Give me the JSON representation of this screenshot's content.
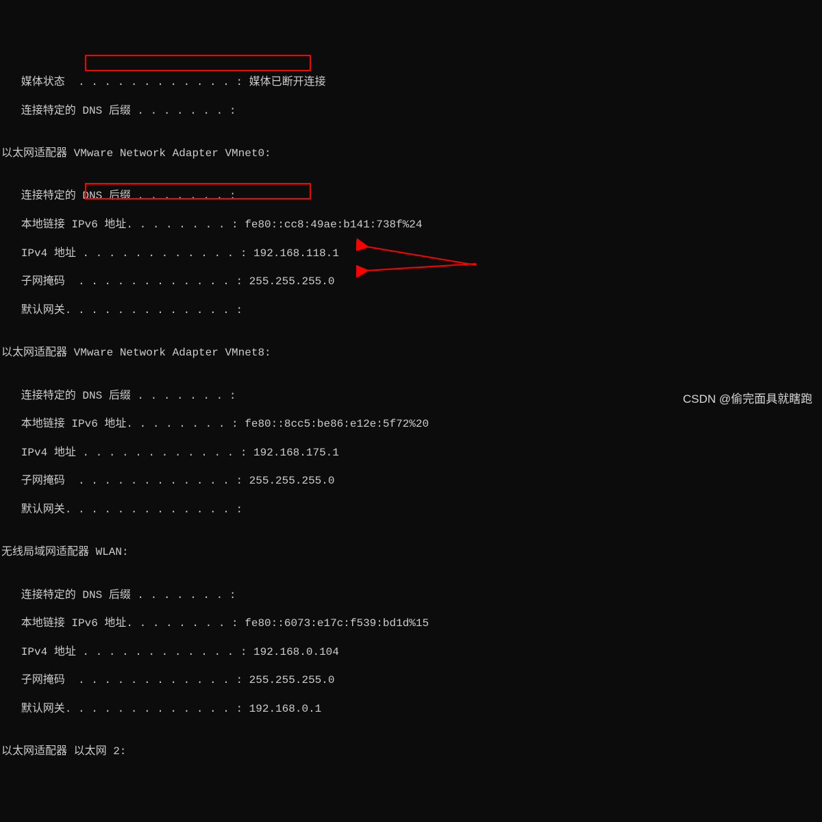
{
  "lines": {
    "l0": "   媒体状态  . . . . . . . . . . . . : 媒体已断开连接",
    "l1": "   连接特定的 DNS 后缀 . . . . . . . :",
    "l2": "",
    "l3_pre": "以太网适配器 ",
    "l3_box": "VMware Network Adapter VMnet0:",
    "l4": "",
    "l5": "   连接特定的 DNS 后缀 . . . . . . . :",
    "l6": "   本地链接 IPv6 地址. . . . . . . . : fe80::cc8:49ae:b141:738f%24",
    "l7": "   IPv4 地址 . . . . . . . . . . . . : 192.168.118.1",
    "l8": "   子网掩码  . . . . . . . . . . . . : 255.255.255.0",
    "l9": "   默认网关. . . . . . . . . . . . . :",
    "l10": "",
    "l11_pre": "以太网适配器 ",
    "l11_box": "VMware Network Adapter VMnet8:",
    "l12": "",
    "l13": "   连接特定的 DNS 后缀 . . . . . . . :",
    "l14": "   本地链接 IPv6 地址. . . . . . . . : fe80::8cc5:be86:e12e:5f72%20",
    "l15": "   IPv4 地址 . . . . . . . . . . . . : 192.168.175.1",
    "l16": "   子网掩码  . . . . . . . . . . . . : 255.255.255.0",
    "l17": "   默认网关. . . . . . . . . . . . . :",
    "l18": "",
    "l19": "无线局域网适配器 WLAN:",
    "l20": "",
    "l21": "   连接特定的 DNS 后缀 . . . . . . . :",
    "l22": "   本地链接 IPv6 地址. . . . . . . . : fe80::6073:e17c:f539:bd1d%15",
    "l23": "   IPv4 地址 . . . . . . . . . . . . : 192.168.0.104",
    "l24": "   子网掩码  . . . . . . . . . . . . : 255.255.255.0",
    "l25": "   默认网关. . . . . . . . . . . . . : 192.168.0.1",
    "l26": "",
    "l27": "以太网适配器 以太网 2:"
  },
  "watermark": "CSDN @偷完面具就瞎跑"
}
